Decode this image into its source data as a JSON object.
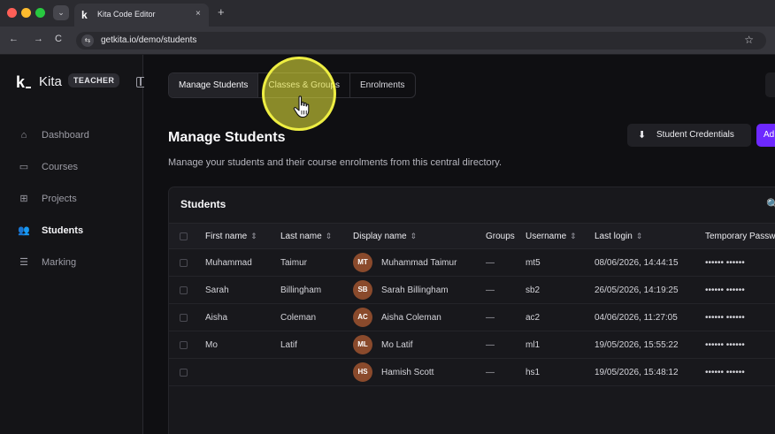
{
  "browser": {
    "tab_title": "Kita Code Editor",
    "tab_close": "×",
    "new_tab": "+",
    "url": "getkita.io/demo/students",
    "back": "←",
    "forward": "→",
    "reload": "C",
    "bookmark": "☆",
    "tab_list": "⌄"
  },
  "sidebar": {
    "logo_letter": "k",
    "brand": "Kita",
    "role": "TEACHER",
    "items": [
      {
        "label": "Dashboard",
        "icon": "home-icon",
        "glyph": "⌂"
      },
      {
        "label": "Courses",
        "icon": "folder-icon",
        "glyph": "▭"
      },
      {
        "label": "Projects",
        "icon": "project-icon",
        "glyph": "⊞"
      },
      {
        "label": "Students",
        "icon": "users-icon",
        "glyph": "👥"
      },
      {
        "label": "Marking",
        "icon": "checklist-icon",
        "glyph": "☰"
      }
    ],
    "active": "Students"
  },
  "tabs": [
    "Manage Students",
    "Classes & Groups",
    "Enrolments"
  ],
  "page": {
    "title": "Manage Students",
    "subtitle": "Manage your students and their course enrolments from this central directory.",
    "credentials_button": "Student Credentials",
    "add_button": "Ad",
    "download_glyph": "⬇"
  },
  "table": {
    "title": "Students",
    "search_glyph": "🔍",
    "sort_glyph": "⇕",
    "columns": [
      "First name",
      "Last name",
      "Display name",
      "Groups",
      "Username",
      "Last login",
      "Temporary Passw"
    ],
    "rows": [
      {
        "first": "Muhammad",
        "last": "Taimur",
        "initials": "MT",
        "display": "Muhammad Taimur",
        "groups": "—",
        "username": "mt5",
        "last_login": "08/06/2026, 14:44:15",
        "password": "•••••• ••••••"
      },
      {
        "first": "Sarah",
        "last": "Billingham",
        "initials": "SB",
        "display": "Sarah Billingham",
        "groups": "—",
        "username": "sb2",
        "last_login": "26/05/2026, 14:19:25",
        "password": "•••••• ••••••"
      },
      {
        "first": "Aisha",
        "last": "Coleman",
        "initials": "AC",
        "display": "Aisha Coleman",
        "groups": "—",
        "username": "ac2",
        "last_login": "04/06/2026, 11:27:05",
        "password": "•••••• ••••••"
      },
      {
        "first": "Mo",
        "last": "Latif",
        "initials": "ML",
        "display": "Mo Latif",
        "groups": "—",
        "username": "ml1",
        "last_login": "19/05/2026, 15:55:22",
        "password": "•••••• ••••••"
      },
      {
        "first": "",
        "last": "",
        "initials": "HS",
        "display": "Hamish Scott",
        "groups": "—",
        "username": "hs1",
        "last_login": "19/05/2026, 15:48:12",
        "password": "•••••• ••••••"
      }
    ]
  },
  "colors": {
    "accent": "#6d28ff",
    "avatar": "#8a4a2c",
    "cursor_highlight": "#f0f03c"
  }
}
